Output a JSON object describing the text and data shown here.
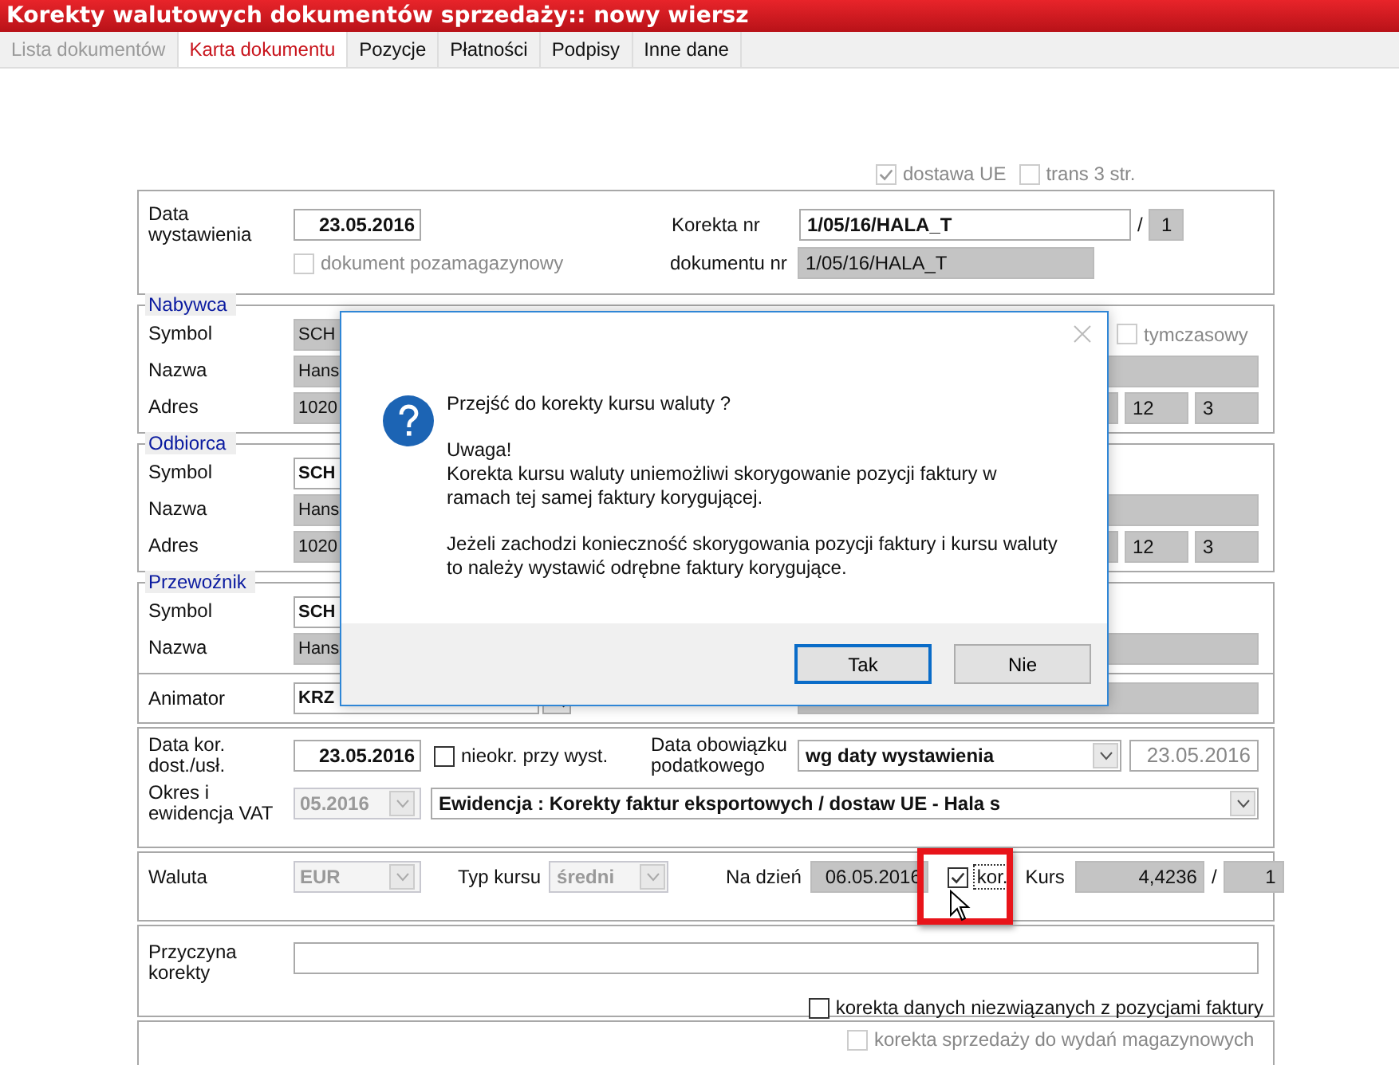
{
  "window": {
    "title": "Korekty walutowych dokumentów sprzedaży:: nowy wiersz"
  },
  "tabs": [
    {
      "label": "Lista dokumentów",
      "selected": false,
      "disabled": true
    },
    {
      "label": "Karta dokumentu",
      "selected": true,
      "disabled": false
    },
    {
      "label": "Pozycje",
      "selected": false,
      "disabled": false
    },
    {
      "label": "Płatności",
      "selected": false,
      "disabled": false
    },
    {
      "label": "Podpisy",
      "selected": false,
      "disabled": false
    },
    {
      "label": "Inne dane",
      "selected": false,
      "disabled": false
    }
  ],
  "flags": [
    {
      "label": "dostawa UE",
      "checked": true,
      "disabled": true
    },
    {
      "label": "trans 3 str.",
      "checked": false,
      "disabled": true
    }
  ],
  "document": {
    "issue_date_label": "Data\nwystawienia",
    "issue_date": "23.05.2016",
    "non_warehouse": {
      "label": "dokument pozamagazynowy",
      "checked": false,
      "disabled": true
    },
    "correction_no_label": "Korekta nr",
    "correction_no": "1/05/16/HALA_T",
    "correction_sep": "/",
    "correction_seq": "1",
    "doc_no_label": "dokumentu nr",
    "doc_no": "1/05/16/HALA_T"
  },
  "parties": [
    {
      "title": "Nabywca",
      "symbol_label": "Symbol",
      "symbol": "SCH",
      "editable": false,
      "temporary": {
        "label": "tymczasowy",
        "checked": false
      },
      "name_label": "Nazwa",
      "name": "Hans",
      "address_label": "Adres",
      "address": "1020",
      "house": "12",
      "flat": "3"
    },
    {
      "title": "Odbiorca",
      "symbol_label": "Symbol",
      "symbol": "SCH",
      "editable": true,
      "name_label": "Nazwa",
      "name": "Hans",
      "address_label": "Adres",
      "address": "1020",
      "house": "12",
      "flat": "3"
    },
    {
      "title": "Przewoźnik",
      "symbol_label": "Symbol",
      "symbol": "SCH",
      "editable": true,
      "name_label": "Nazwa",
      "name": "Hans"
    }
  ],
  "animator": {
    "label": "Animator",
    "value": "KRZ"
  },
  "dates": {
    "delivery_label": "Data kor.\ndost./usł.",
    "delivery_date": "23.05.2016",
    "undefined": {
      "label": "nieokr. przy wyst.",
      "checked": false
    },
    "tax_label": "Data obowiązku\npodatkowego",
    "tax_mode": "wg daty wystawienia",
    "tax_date": "23.05.2016",
    "period_label": "Okres i\newidencja VAT",
    "period": "05.2016",
    "register": "Ewidencja : Korekty faktur eksportowych / dostaw UE - Hala s"
  },
  "currency": {
    "label": "Waluta",
    "value": "EUR",
    "rate_type_label": "Typ kursu",
    "rate_type": "średni",
    "on_day_label": "Na dzień",
    "on_day": "06.05.2016",
    "kor": {
      "label": "kor.",
      "checked": true
    },
    "rate_label": "Kurs",
    "rate": "4,4236",
    "unit_sep": "/",
    "unit": "1"
  },
  "reason": {
    "label": "Przyczyna\nkorekty",
    "unrelated": {
      "label": "korekta danych niezwiązanych z pozycjami faktury",
      "checked": false
    }
  },
  "warehouse": {
    "label": "korekta sprzedaży do wydań magazynowych",
    "checked": false,
    "disabled": true
  },
  "dialog": {
    "question": "Przejść do korekty kursu waluty ?",
    "paragraphs": [
      "Uwaga!\nKorekta kursu waluty uniemożliwi skorygowanie pozycji faktury w\nramach tej samej faktury korygującej.",
      "Jeżeli zachodzi konieczność skorygowania pozycji faktury i kursu waluty\nto należy wystawić odrębne faktury korygujące."
    ],
    "buttons": [
      {
        "label": "Tak",
        "default": true
      },
      {
        "label": "Nie",
        "default": false
      }
    ]
  }
}
